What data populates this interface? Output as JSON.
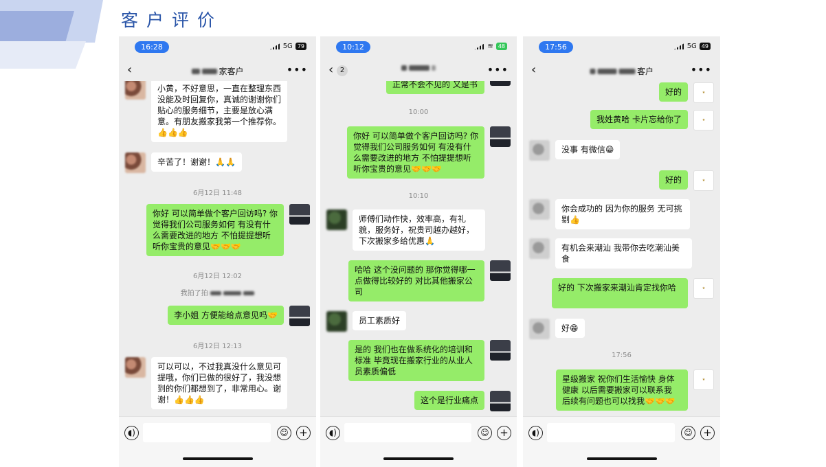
{
  "page_title": "客户评价",
  "phones": [
    {
      "time": "16:28",
      "network": "5G",
      "battery": "79",
      "title": "家客户",
      "messages": [
        {
          "type": "msg",
          "side": "left",
          "text": "小黄，不好意思，一直在整理东西没能及时回复你，真诚的谢谢你们贴心的服务细节，主要是放心满意。有朋友搬家我第一个推荐你。👍👍👍"
        },
        {
          "type": "msg",
          "side": "left",
          "text": "辛苦了！谢谢！🙏🙏"
        },
        {
          "type": "time",
          "text": "6月12日 11:48"
        },
        {
          "type": "msg",
          "side": "right",
          "text": "你好 可以简单做个客户回访吗? 你觉得我们公司服务如何 有没有什么需要改进的地方 不怕提提想听听你宝贵的意见🤝🤝🤝"
        },
        {
          "type": "time",
          "text": "6月12日 12:02"
        },
        {
          "type": "system",
          "text": "我拍了拍"
        },
        {
          "type": "msg",
          "side": "right",
          "text": "李小姐 方便能给点意见吗🤝"
        },
        {
          "type": "time",
          "text": "6月12日 12:13"
        },
        {
          "type": "msg",
          "side": "left",
          "text": "可以可以，不过我真没什么意见可提哦，你们已做的很好了，我没想到的你们都想到了，非常用心。谢谢！👍👍👍"
        }
      ]
    },
    {
      "time": "10:12",
      "network": "",
      "battery": "48",
      "badge": "2",
      "title": "",
      "messages": [
        {
          "type": "msg",
          "side": "right",
          "text": "正常不会不见的 又是书"
        },
        {
          "type": "time",
          "text": "10:00"
        },
        {
          "type": "msg",
          "side": "right",
          "text": "你好 可以简单做个客户回访吗? 你觉得我们公司服务如何 有没有什么需要改进的地方 不怕提提想听听你宝贵的意见🤝🤝🤝"
        },
        {
          "type": "time",
          "text": "10:10"
        },
        {
          "type": "msg",
          "side": "left",
          "text": "师傅们动作快，效率高，有礼貌，服务好，祝贵司越办越好，下次搬家多给优惠🙏"
        },
        {
          "type": "msg",
          "side": "right",
          "text": "哈哈 这个没问题的 那你觉得哪一点做得比较好的 对比其他搬家公司"
        },
        {
          "type": "msg",
          "side": "left",
          "text": "员工素质好"
        },
        {
          "type": "msg",
          "side": "right",
          "text": "是的 我们也在做系统化的培训和标准 毕竟现在搬家行业的从业人员素质偏低"
        },
        {
          "type": "msg",
          "side": "right",
          "text": "这个是行业痛点"
        }
      ]
    },
    {
      "time": "17:56",
      "network": "5G",
      "battery": "49",
      "title": "客户",
      "messages": [
        {
          "type": "msg",
          "side": "right",
          "text": "好的"
        },
        {
          "type": "msg",
          "side": "right",
          "text": "我姓黄哈 卡片忘给你了"
        },
        {
          "type": "msg",
          "side": "left",
          "text": "没事 有微信😁"
        },
        {
          "type": "msg",
          "side": "right",
          "text": "好的"
        },
        {
          "type": "msg",
          "side": "left",
          "text": "你会成功的 因为你的服务 无可挑剔👍"
        },
        {
          "type": "msg",
          "side": "left",
          "text": "有机会来潮汕 我带你去吃潮汕美食"
        },
        {
          "type": "msg",
          "side": "right",
          "text": "好的 下次搬家来潮汕肯定找你哈"
        },
        {
          "type": "msg",
          "side": "left",
          "text": "好😁"
        },
        {
          "type": "time",
          "text": "17:56"
        },
        {
          "type": "msg",
          "side": "right",
          "text": "星级搬家 祝你们生活愉快 身体健康 以后需要搬家可以联系我 后续有问题也可以找我🤝🤝🤝"
        }
      ]
    }
  ],
  "icons": {
    "back": "‹",
    "more": "•••",
    "voice": "◖)",
    "emoji": "☺",
    "plus": "+",
    "wifi": "≋"
  },
  "colors": {
    "title_blue": "#2a55a8",
    "time_pill": "#2f78f0",
    "bubble_green": "#95ec69",
    "chat_bg": "#ededed"
  }
}
